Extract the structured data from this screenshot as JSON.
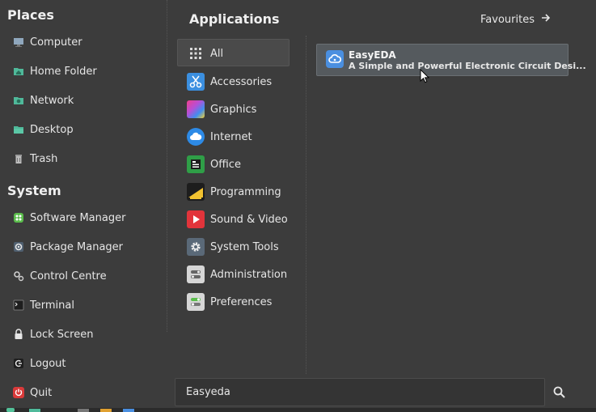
{
  "places": {
    "title": "Places",
    "items": [
      {
        "label": "Computer",
        "icon": "computer-icon"
      },
      {
        "label": "Home Folder",
        "icon": "home-folder-icon"
      },
      {
        "label": "Network",
        "icon": "network-folder-icon"
      },
      {
        "label": "Desktop",
        "icon": "desktop-folder-icon"
      },
      {
        "label": "Trash",
        "icon": "trash-icon"
      }
    ]
  },
  "system": {
    "title": "System",
    "items": [
      {
        "label": "Software Manager",
        "icon": "software-manager-icon"
      },
      {
        "label": "Package Manager",
        "icon": "package-manager-icon"
      },
      {
        "label": "Control Centre",
        "icon": "control-centre-icon"
      },
      {
        "label": "Terminal",
        "icon": "terminal-icon"
      },
      {
        "label": "Lock Screen",
        "icon": "lock-icon"
      },
      {
        "label": "Logout",
        "icon": "logout-icon"
      },
      {
        "label": "Quit",
        "icon": "power-icon"
      }
    ]
  },
  "applications": {
    "title": "Applications",
    "favourites_label": "Favourites",
    "categories": [
      {
        "label": "All",
        "icon": "grid-icon",
        "color": "#4a4a4a"
      },
      {
        "label": "Accessories",
        "icon": "scissors-icon",
        "color": "#3b8fe0"
      },
      {
        "label": "Graphics",
        "icon": "palette-icon",
        "color": "#b64fd6"
      },
      {
        "label": "Internet",
        "icon": "cloud-icon",
        "color": "#2d8ae6"
      },
      {
        "label": "Office",
        "icon": "office-icon",
        "color": "#2f9e47"
      },
      {
        "label": "Programming",
        "icon": "programming-icon",
        "color": "#f2c230"
      },
      {
        "label": "Sound & Video",
        "icon": "play-icon",
        "color": "#e2343b"
      },
      {
        "label": "System Tools",
        "icon": "gear-icon",
        "color": "#5a6978"
      },
      {
        "label": "Administration",
        "icon": "admin-icon",
        "color": "#d6d6d6"
      },
      {
        "label": "Preferences",
        "icon": "toggles-icon",
        "color": "#d6d6d6"
      }
    ],
    "results": [
      {
        "name": "EasyEDA",
        "description": "A Simple and Powerful Electronic Circuit Desi...",
        "icon": "easyeda-icon",
        "color": "#4a8fe0"
      }
    ]
  },
  "search": {
    "value": "Easyeda",
    "icon": "search-icon"
  },
  "colors": {
    "background": "#3c3c3c",
    "selected": "#555a5e",
    "accent_green": "#53c29a"
  }
}
